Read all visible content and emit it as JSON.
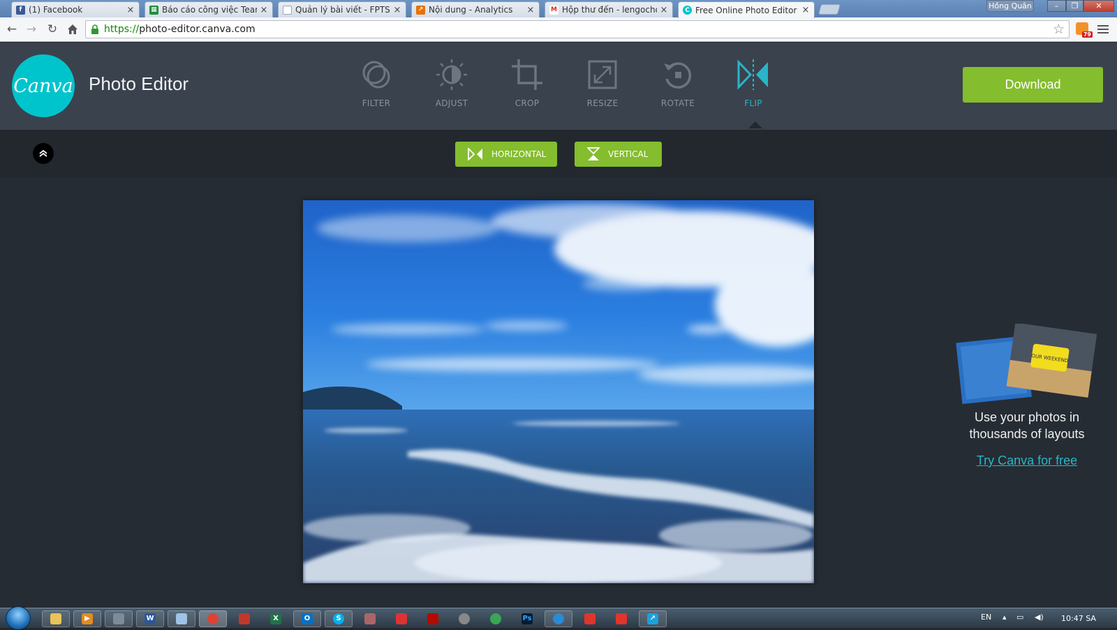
{
  "browser": {
    "tabs": [
      {
        "label": "(1) Facebook",
        "icon": "facebook-icon",
        "color": "#3b5998"
      },
      {
        "label": "Báo cáo công việc Team C",
        "icon": "sheets-icon",
        "color": "#1e8e3e"
      },
      {
        "label": "Quản lý bài viết - FPTShop",
        "icon": "page-icon",
        "color": "#9aa7b8"
      },
      {
        "label": "Nội dung - Analytics",
        "icon": "analytics-icon",
        "color": "#e8710a"
      },
      {
        "label": "Hộp thư đến - lengochong",
        "icon": "gmail-icon",
        "color": "#d93025"
      },
      {
        "label": "Free Online Photo Editor",
        "icon": "canva-favicon-icon",
        "color": "#00c4cc"
      }
    ],
    "user": "Hồng Quân",
    "url_scheme": "https://",
    "url_host": "photo-editor.canva.com",
    "rss_badge": "79"
  },
  "app": {
    "logo_text": "Canva",
    "title": "Photo Editor",
    "tools": [
      {
        "label": "FILTER",
        "icon": "filter-icon"
      },
      {
        "label": "ADJUST",
        "icon": "adjust-icon"
      },
      {
        "label": "CROP",
        "icon": "crop-icon"
      },
      {
        "label": "RESIZE",
        "icon": "resize-icon"
      },
      {
        "label": "ROTATE",
        "icon": "rotate-icon"
      },
      {
        "label": "FLIP",
        "icon": "flip-icon",
        "active": true
      }
    ],
    "download_label": "Download",
    "flip_options": [
      "HORIZONTAL",
      "VERTICAL"
    ],
    "accent_color": "#29b5c8",
    "button_color": "#84bd2d"
  },
  "promo": {
    "text_line1": "Use your photos in",
    "text_line2": "thousands of layouts",
    "card_text": "OUR WEEKEND",
    "link": "Try Canva for free"
  },
  "taskbar": {
    "language": "EN",
    "time": "10:47 SA"
  }
}
